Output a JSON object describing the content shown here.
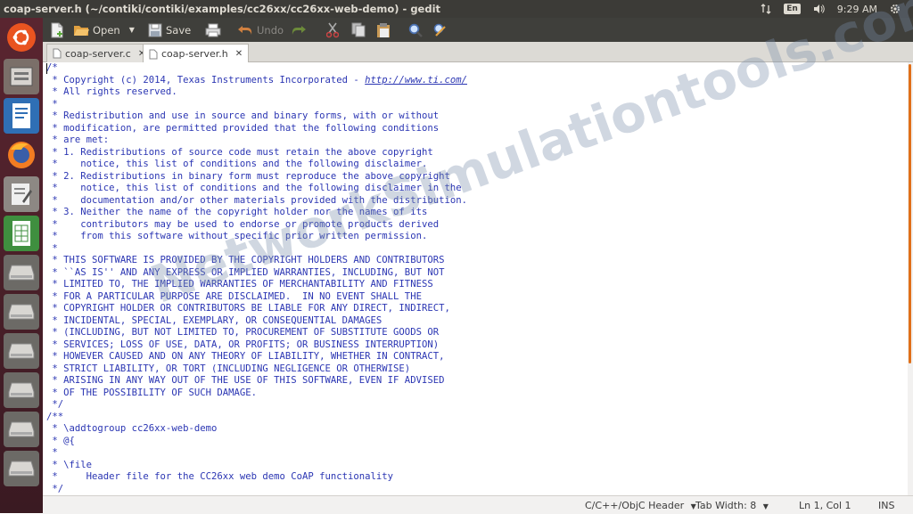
{
  "window": {
    "title": "coap-server.h (~/contiki/contiki/examples/cc26xx/cc26xx-web-demo) - gedit"
  },
  "panel": {
    "keyboard_layout": "En",
    "clock": "9:29 AM"
  },
  "toolbar": {
    "open_label": "Open",
    "save_label": "Save",
    "undo_label": "Undo"
  },
  "tabs": [
    {
      "label": "coap-server.c"
    },
    {
      "label": "coap-server.h"
    }
  ],
  "editor": {
    "lines": [
      "/*",
      " * Copyright (c) 2014, Texas Instruments Incorporated - ",
      " * All rights reserved.",
      " *",
      " * Redistribution and use in source and binary forms, with or without",
      " * modification, are permitted provided that the following conditions",
      " * are met:",
      " * 1. Redistributions of source code must retain the above copyright",
      " *    notice, this list of conditions and the following disclaimer.",
      " * 2. Redistributions in binary form must reproduce the above copyright",
      " *    notice, this list of conditions and the following disclaimer in the",
      " *    documentation and/or other materials provided with the distribution.",
      " * 3. Neither the name of the copyright holder nor the names of its",
      " *    contributors may be used to endorse or promote products derived",
      " *    from this software without specific prior written permission.",
      " *",
      " * THIS SOFTWARE IS PROVIDED BY THE COPYRIGHT HOLDERS AND CONTRIBUTORS",
      " * ``AS IS'' AND ANY EXPRESS OR IMPLIED WARRANTIES, INCLUDING, BUT NOT",
      " * LIMITED TO, THE IMPLIED WARRANTIES OF MERCHANTABILITY AND FITNESS",
      " * FOR A PARTICULAR PURPOSE ARE DISCLAIMED.  IN NO EVENT SHALL THE",
      " * COPYRIGHT HOLDER OR CONTRIBUTORS BE LIABLE FOR ANY DIRECT, INDIRECT,",
      " * INCIDENTAL, SPECIAL, EXEMPLARY, OR CONSEQUENTIAL DAMAGES",
      " * (INCLUDING, BUT NOT LIMITED TO, PROCUREMENT OF SUBSTITUTE GOODS OR",
      " * SERVICES; LOSS OF USE, DATA, OR PROFITS; OR BUSINESS INTERRUPTION)",
      " * HOWEVER CAUSED AND ON ANY THEORY OF LIABILITY, WHETHER IN CONTRACT,",
      " * STRICT LIABILITY, OR TORT (INCLUDING NEGLIGENCE OR OTHERWISE)",
      " * ARISING IN ANY WAY OUT OF THE USE OF THIS SOFTWARE, EVEN IF ADVISED",
      " * OF THE POSSIBILITY OF SUCH DAMAGE.",
      " */",
      "/**",
      " * \\addtogroup cc26xx-web-demo",
      " * @{",
      " *",
      " * \\file",
      " *     Header file for the CC26xx web demo CoAP functionality",
      " */"
    ],
    "link": "http://www.ti.com/",
    "link_line": 1
  },
  "statusbar": {
    "language": "C/C++/ObjC Header",
    "tab_width": "Tab Width: 8",
    "position": "Ln 1, Col 1",
    "insert_mode": "INS"
  },
  "watermark": "NetworkSimulationtools.com",
  "colors": {
    "panel": "#3c3b37",
    "launcher": "#4a1f29",
    "code_text": "#2b36b3",
    "scroll_thumb": "#e0701a"
  }
}
